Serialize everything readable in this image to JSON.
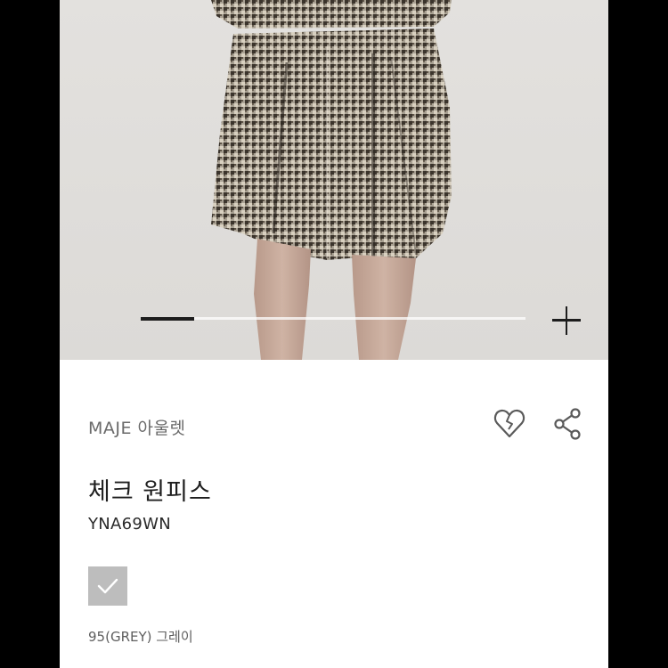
{
  "gallery": {
    "image_description_icon": "product-photo",
    "progress": 0.14,
    "zoom_icon": "plus-icon"
  },
  "product": {
    "brand": "MAJE 아울렛",
    "name": "체크 원피스",
    "code": "YNA69WN",
    "actions": [
      {
        "icon": "heart-icon"
      },
      {
        "icon": "share-icon"
      },
      {
        "icon": "chat-question-icon"
      }
    ],
    "color": {
      "swatch_hex": "#bdbdbd",
      "label": "95(GREY) 그레이",
      "selected": true
    }
  },
  "colors": {
    "page_bg": "#ffffff",
    "outer_bg": "#000000",
    "text_primary": "#1f1f1f",
    "text_muted": "#6a6a6a"
  }
}
